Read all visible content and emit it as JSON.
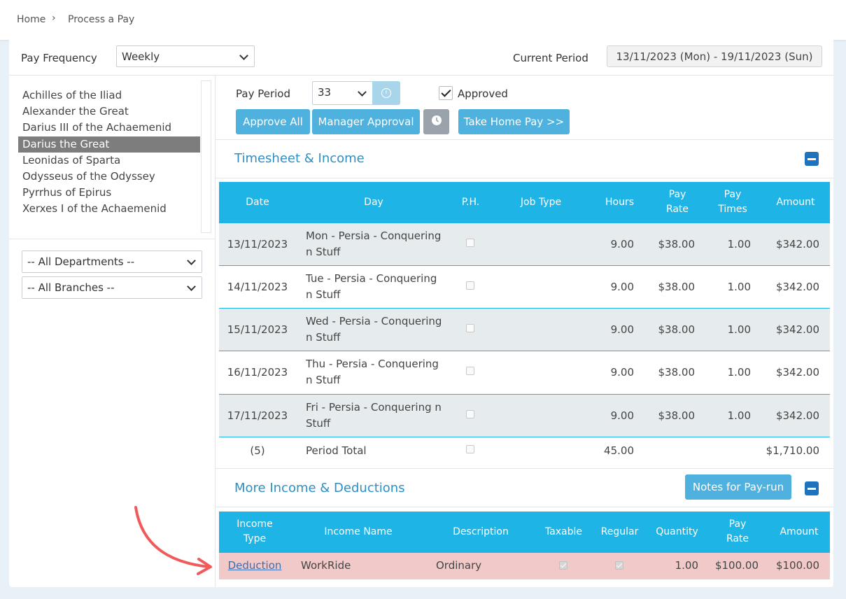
{
  "breadcrumb": {
    "home": "Home",
    "sep": "›",
    "current": "Process a Pay"
  },
  "filters": {
    "pay_frequency_label": "Pay Frequency",
    "pay_frequency_value": "Weekly",
    "current_period_label": "Current Period",
    "current_period_value": "13/11/2023 (Mon) - 19/11/2023 (Sun)"
  },
  "employees": [
    "Achilles of the Iliad",
    "Alexander the Great",
    "Darius III of the Achaemenid",
    "Darius the Great",
    "Leonidas of Sparta",
    "Odysseus of the Odyssey",
    "Pyrrhus of Epirus",
    "Xerxes I of the Achaemenid"
  ],
  "selected_employee": "Darius the Great",
  "department_filter": "-- All Departments --",
  "branch_filter": "-- All Branches --",
  "pay_period": {
    "label": "Pay Period",
    "value": "33",
    "approved_label": "Approved",
    "approved": true
  },
  "buttons": {
    "approve_all": "Approve All",
    "manager_approval": "Manager Approval",
    "take_home_pay": "Take Home Pay >>",
    "notes": "Notes for Pay-run"
  },
  "timesheet": {
    "title": "Timesheet & Income",
    "headers": [
      "Date",
      "Day",
      "P.H.",
      "Job Type",
      "Hours",
      "Pay Rate",
      "Pay Times",
      "Amount"
    ],
    "rows": [
      {
        "date": "13/11/2023",
        "day_line1": "Mon - Persia - Conquering",
        "day_line2": "n Stuff",
        "hours": "9.00",
        "rate": "$38.00",
        "times": "1.00",
        "amount": "$342.00"
      },
      {
        "date": "14/11/2023",
        "day_line1": "Tue - Persia - Conquering",
        "day_line2": "n Stuff",
        "hours": "9.00",
        "rate": "$38.00",
        "times": "1.00",
        "amount": "$342.00"
      },
      {
        "date": "15/11/2023",
        "day_line1": "Wed - Persia - Conquering",
        "day_line2": "n Stuff",
        "hours": "9.00",
        "rate": "$38.00",
        "times": "1.00",
        "amount": "$342.00"
      },
      {
        "date": "16/11/2023",
        "day_line1": "Thu - Persia - Conquering",
        "day_line2": "n Stuff",
        "hours": "9.00",
        "rate": "$38.00",
        "times": "1.00",
        "amount": "$342.00"
      },
      {
        "date": "17/11/2023",
        "day_line1": "Fri - Persia - Conquering n",
        "day_line2": "Stuff",
        "hours": "9.00",
        "rate": "$38.00",
        "times": "1.00",
        "amount": "$342.00"
      }
    ],
    "total": {
      "count": "(5)",
      "label": "Period Total",
      "hours": "45.00",
      "amount": "$1,710.00"
    }
  },
  "deductions": {
    "title": "More Income & Deductions",
    "headers": [
      "Income Type",
      "Income Name",
      "Description",
      "Taxable",
      "Regular",
      "Quantity",
      "Pay Rate",
      "Amount"
    ],
    "rows": [
      {
        "type": "Deduction",
        "name": "WorkRide",
        "description": "Ordinary",
        "taxable": true,
        "regular": true,
        "quantity": "1.00",
        "rate": "$100.00",
        "amount": "$100.00"
      }
    ]
  },
  "colors": {
    "header": "#1fb4e6",
    "button": "#4fb2de",
    "title": "#2e8fc4",
    "highlight_row": "#f2c9c9",
    "arrow": "#f05a5a"
  }
}
